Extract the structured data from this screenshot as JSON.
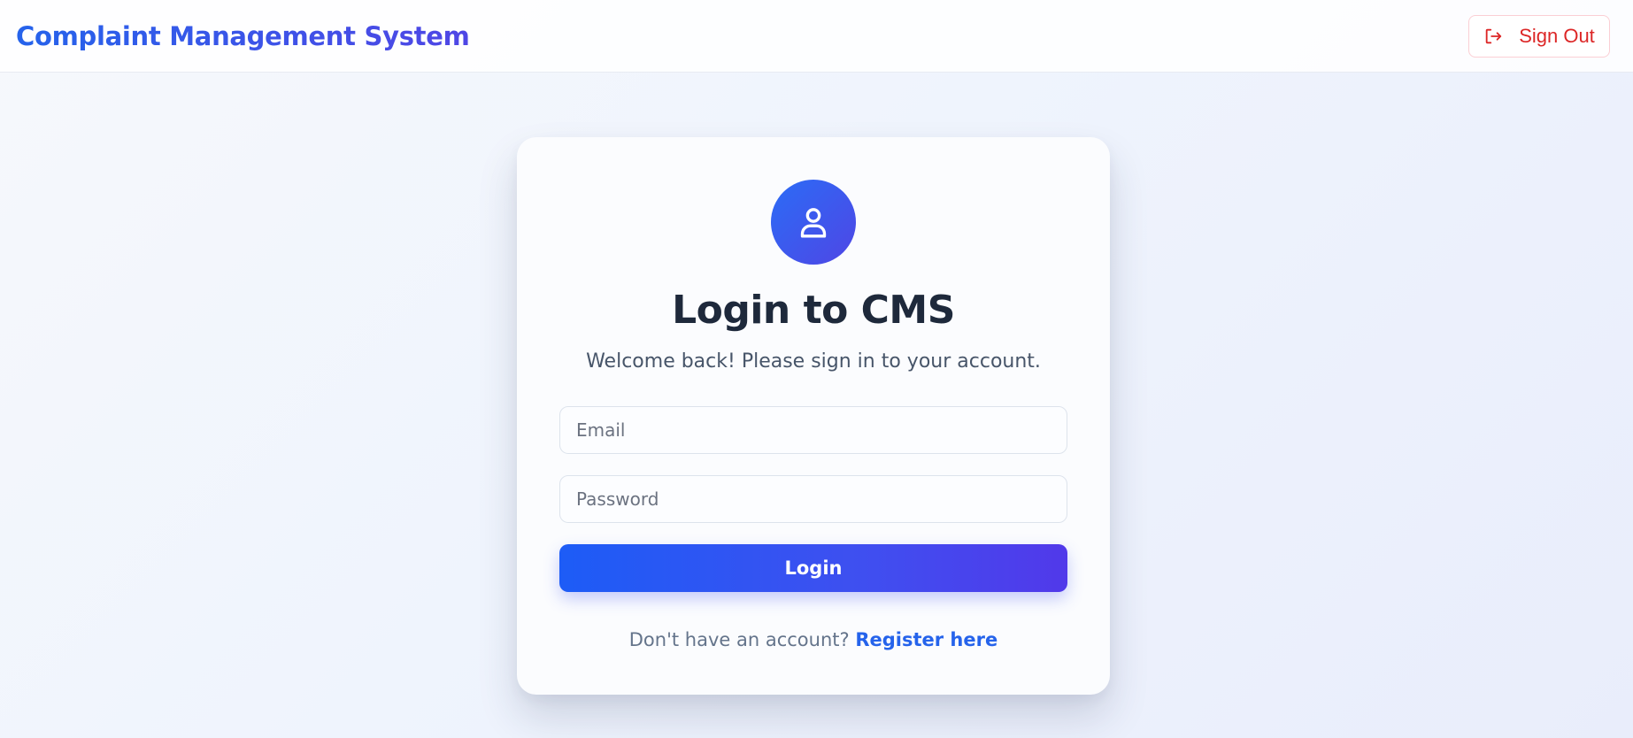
{
  "header": {
    "brand": "Complaint Management System",
    "signout_label": "Sign Out",
    "signout_icon": "sign-out-icon"
  },
  "login": {
    "avatar_icon": "user-icon",
    "title": "Login to CMS",
    "subtitle": "Welcome back! Please sign in to your account.",
    "email_placeholder": "Email",
    "email_value": "",
    "password_placeholder": "Password",
    "password_value": "",
    "submit_label": "Login",
    "footer_prompt": "Don't have an account?",
    "register_link": "Register here"
  },
  "colors": {
    "brand_start": "#2563eb",
    "brand_end": "#4f46e5",
    "signout": "#dc2626",
    "link": "#2563eb"
  }
}
